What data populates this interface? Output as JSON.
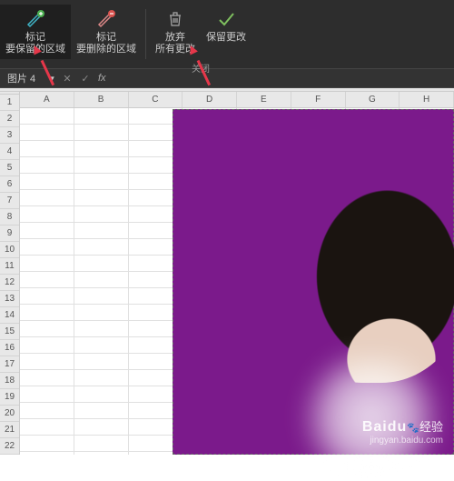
{
  "ribbon": {
    "mark_keep": {
      "line1": "标记",
      "line2": "要保留的区域"
    },
    "mark_remove": {
      "line1": "标记",
      "line2": "要删除的区域"
    },
    "discard": {
      "line1": "放弃",
      "line2": "所有更改"
    },
    "keep_changes": {
      "line1": "保留更改"
    },
    "group_close": "关闭"
  },
  "namebox": {
    "value": "图片 4",
    "fx_label": "fx"
  },
  "columns": [
    "A",
    "B",
    "C",
    "D",
    "E",
    "F",
    "G",
    "H"
  ],
  "rows": [
    "1",
    "2",
    "3",
    "4",
    "5",
    "6",
    "7",
    "8",
    "9",
    "10",
    "11",
    "12",
    "13",
    "14",
    "15",
    "16",
    "17",
    "18",
    "19",
    "20",
    "21",
    "22"
  ],
  "watermark": {
    "brand": "Baidu",
    "suffix": "经验",
    "url": "jingyan.baidu.com"
  }
}
